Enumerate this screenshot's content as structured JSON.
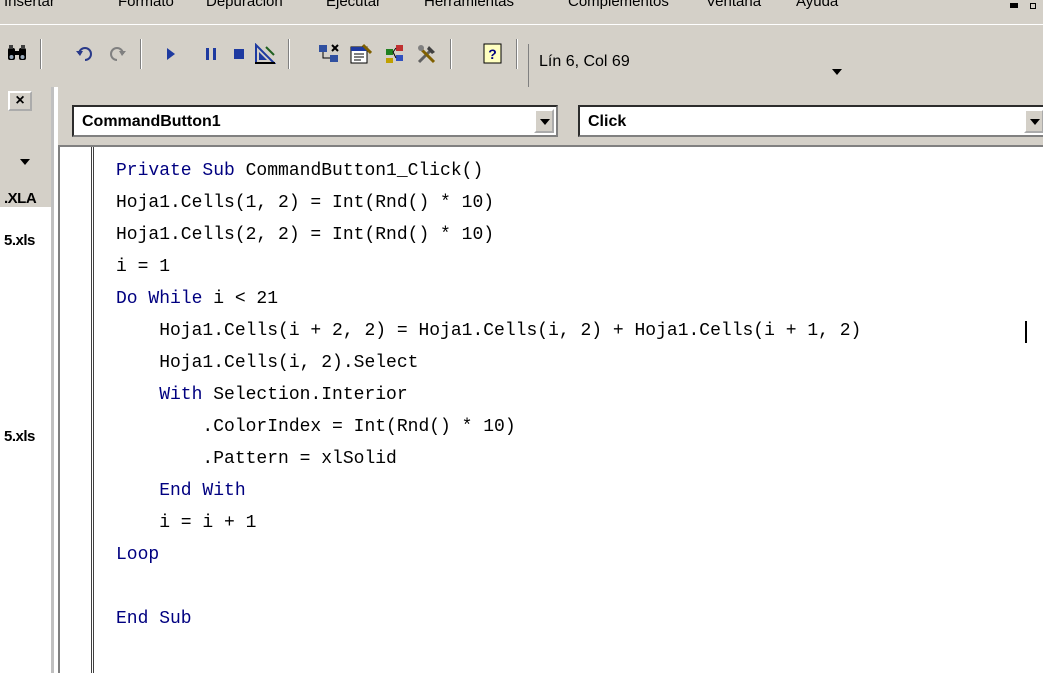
{
  "menubar": {
    "items": [
      "Insertar",
      "Formato",
      "Depuración",
      "Ejecutar",
      "Herramientas",
      "Complementos",
      "Ventana",
      "Ayuda"
    ]
  },
  "toolbar": {
    "icons": [
      "find-icon",
      "undo-icon",
      "redo-icon",
      "run-icon",
      "break-icon",
      "reset-icon",
      "design-mode-icon",
      "project-explorer-icon",
      "properties-icon",
      "object-browser-icon",
      "toolbox-icon",
      "help-icon"
    ],
    "position": "Lín 6, Col 69"
  },
  "project_pane": {
    "close_label": "×",
    "files": [
      ".XLA",
      "5.xls",
      "5.xls"
    ]
  },
  "code_window": {
    "object_combo": "CommandButton1",
    "procedure_combo": "Click",
    "lines": [
      {
        "kw": "Private Sub",
        "text": " CommandButton1_Click()"
      },
      {
        "kw": "",
        "text": "Hoja1.Cells(1, 2) = Int(Rnd() * 10)"
      },
      {
        "kw": "",
        "text": "Hoja1.Cells(2, 2) = Int(Rnd() * 10)"
      },
      {
        "kw": "",
        "text": "i = 1"
      },
      {
        "kw": "Do While",
        "text": " i < 21"
      },
      {
        "kw": "",
        "text": "    Hoja1.Cells(i + 2, 2) = Hoja1.Cells(i, 2) + Hoja1.Cells(i + 1, 2)"
      },
      {
        "kw": "",
        "text": "    Hoja1.Cells(i, 2).Select"
      },
      {
        "kw": "    With",
        "text": " Selection.Interior"
      },
      {
        "kw": "",
        "text": "        .ColorIndex = Int(Rnd() * 10)"
      },
      {
        "kw": "",
        "text": "        .Pattern = xlSolid"
      },
      {
        "kw": "    End With",
        "text": ""
      },
      {
        "kw": "",
        "text": "    i = i + 1"
      },
      {
        "kw": "Loop",
        "text": ""
      },
      {
        "kw": "",
        "text": ""
      },
      {
        "kw": "End Sub",
        "text": ""
      }
    ]
  },
  "colors": {
    "keyword": "#000080",
    "chrome": "#d4d0c8"
  }
}
